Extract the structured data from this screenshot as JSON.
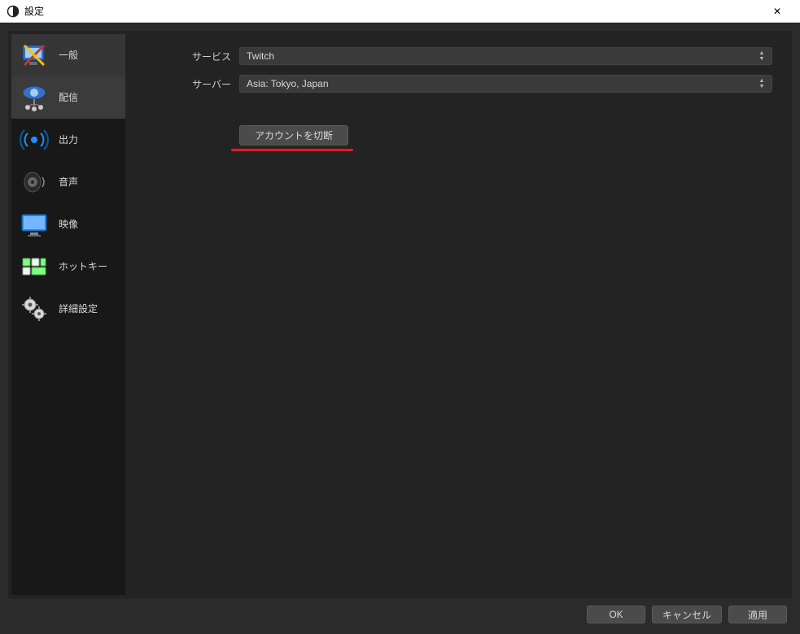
{
  "window": {
    "title": "設定",
    "close_label": "✕"
  },
  "sidebar": {
    "items": [
      {
        "id": "general",
        "label": "一般",
        "icon": "monitor-tools-icon",
        "selected_class": "general"
      },
      {
        "id": "stream",
        "label": "配信",
        "icon": "network-icon",
        "selected_class": "selected"
      },
      {
        "id": "output",
        "label": "出力",
        "icon": "broadcast-icon",
        "selected_class": ""
      },
      {
        "id": "audio",
        "label": "音声",
        "icon": "speaker-icon",
        "selected_class": ""
      },
      {
        "id": "video",
        "label": "映像",
        "icon": "display-icon",
        "selected_class": ""
      },
      {
        "id": "hotkeys",
        "label": "ホットキー",
        "icon": "keyboard-icon",
        "selected_class": ""
      },
      {
        "id": "advanced",
        "label": "詳細設定",
        "icon": "gears-icon",
        "selected_class": ""
      }
    ]
  },
  "form": {
    "service_label": "サービス",
    "service_value": "Twitch",
    "server_label": "サーバー",
    "server_value": "Asia: Tokyo, Japan",
    "disconnect_label": "アカウントを切断"
  },
  "footer": {
    "ok": "OK",
    "cancel": "キャンセル",
    "apply": "適用"
  },
  "colors": {
    "annotation_underline": "#e31b23"
  }
}
